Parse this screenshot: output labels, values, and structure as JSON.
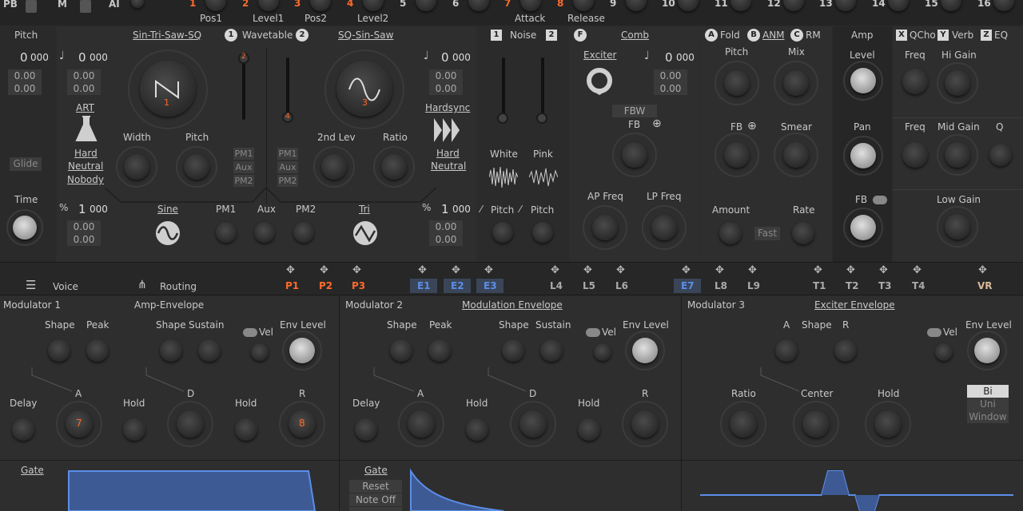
{
  "topbar": {
    "pb": "PB",
    "m": "M",
    "ai": "AI",
    "macros": [
      {
        "num": "1",
        "label": "Pos1",
        "accent": true
      },
      {
        "num": "2",
        "label": "Level1",
        "accent": true
      },
      {
        "num": "3",
        "label": "Pos2",
        "accent": true
      },
      {
        "num": "4",
        "label": "Level2",
        "accent": true
      },
      {
        "num": "5",
        "label": "",
        "accent": false
      },
      {
        "num": "6",
        "label": "",
        "accent": false
      },
      {
        "num": "7",
        "label": "Attack",
        "accent": true
      },
      {
        "num": "8",
        "label": "Release",
        "accent": true
      },
      {
        "num": "9",
        "label": "",
        "accent": false
      },
      {
        "num": "10",
        "label": "",
        "accent": false
      },
      {
        "num": "11",
        "label": "",
        "accent": false
      },
      {
        "num": "12",
        "label": "",
        "accent": false
      },
      {
        "num": "13",
        "label": "",
        "accent": false
      },
      {
        "num": "14",
        "label": "",
        "accent": false
      },
      {
        "num": "15",
        "label": "",
        "accent": false
      },
      {
        "num": "16",
        "label": "",
        "accent": false
      }
    ]
  },
  "pitch": {
    "title": "Pitch",
    "value": "0",
    "cents": "000",
    "f1": "0.00",
    "f2": "0.00",
    "glide": "Glide",
    "time": "Time"
  },
  "osc1": {
    "title": "Sin-Tri-Saw-SQ",
    "wavetable": "Wavetable",
    "b1": "1",
    "b2": "2",
    "knob_badge": "1",
    "slider_badge": "2",
    "coarse": "0",
    "cents": "000",
    "f1": "0.00",
    "f2": "0.00",
    "art": "ART",
    "art_l1": "Hard",
    "art_l2": "Neutral",
    "art_l3": "Nobody",
    "width": "Width",
    "pitch": "Pitch",
    "pm1": "PM1",
    "aux": "Aux",
    "pm2": "PM2"
  },
  "osc2": {
    "title": "SQ-Sin-Saw",
    "coarse": "0",
    "cents": "000",
    "f1": "0.00",
    "f2": "0.00",
    "knob_badge": "3",
    "slider_badge": "4",
    "hardsync": "Hardsync",
    "hs_l1": "Hard",
    "hs_l2": "Neutral",
    "lev": "2nd Lev",
    "ratio": "Ratio",
    "pm1": "PM1",
    "aux": "Aux",
    "pm2": "PM2"
  },
  "sub": {
    "pct": "%",
    "val": "1",
    "cents": "000",
    "f1": "0.00",
    "f2": "0.00",
    "sine": "Sine",
    "pm1": "PM1",
    "aux": "Aux",
    "pm2": "PM2",
    "tri": "Tri",
    "pct2": "%",
    "val2": "1",
    "cents2": "000",
    "f3": "0.00",
    "f4": "0.00"
  },
  "noise": {
    "b1": "1",
    "title": "Noise",
    "b2": "2",
    "white": "White",
    "pink": "Pink",
    "pitch1": "Pitch",
    "pitch2": "Pitch"
  },
  "comb": {
    "badge": "F",
    "title": "Comb",
    "exciter": "Exciter",
    "coarse": "0",
    "cents": "000",
    "f1": "0.00",
    "f2": "0.00",
    "fbw": "FBW",
    "fb": "FB",
    "ap": "AP Freq",
    "lp": "LP Freq"
  },
  "fold": {
    "a": "A",
    "fold": "Fold",
    "b": "B",
    "anm": "ANM",
    "c": "C",
    "rm": "RM",
    "pitch": "Pitch",
    "mix": "Mix",
    "fb": "FB",
    "smear": "Smear",
    "amount": "Amount",
    "fast": "Fast",
    "rate": "Rate"
  },
  "amp": {
    "title": "Amp",
    "level": "Level",
    "pan": "Pan",
    "fb": "FB"
  },
  "fx": {
    "x": "X",
    "qcho": "QCho",
    "y": "Y",
    "verb": "Verb",
    "z": "Z",
    "eq": "EQ",
    "freq1": "Freq",
    "hi": "Hi Gain",
    "freq2": "Freq",
    "mid": "Mid Gain",
    "q": "Q",
    "low": "Low Gain"
  },
  "modbar": {
    "voice": "Voice",
    "routing": "Routing",
    "slots": [
      {
        "label": "P1",
        "color": "orange"
      },
      {
        "label": "P2",
        "color": "orange"
      },
      {
        "label": "P3",
        "color": "orange"
      },
      {
        "label": "E1",
        "color": "blue"
      },
      {
        "label": "E2",
        "color": "blue"
      },
      {
        "label": "E3",
        "color": "blue"
      },
      {
        "label": "L4",
        "color": "grey"
      },
      {
        "label": "L5",
        "color": "grey"
      },
      {
        "label": "L6",
        "color": "grey"
      },
      {
        "label": "E7",
        "color": "blue"
      },
      {
        "label": "L8",
        "color": "grey"
      },
      {
        "label": "L9",
        "color": "grey"
      },
      {
        "label": "T1",
        "color": "grey"
      },
      {
        "label": "T2",
        "color": "grey"
      },
      {
        "label": "T3",
        "color": "grey"
      },
      {
        "label": "T4",
        "color": "grey"
      },
      {
        "label": "VR",
        "color": "tan"
      }
    ]
  },
  "mod1": {
    "title": "Modulator 1",
    "env": "Amp-Envelope",
    "shape1": "Shape",
    "peak": "Peak",
    "shape2": "Shape",
    "sustain": "Sustain",
    "vel": "Vel",
    "envlevel": "Env Level",
    "a": "A",
    "d": "D",
    "delay": "Delay",
    "hold1": "Hold",
    "hold2": "Hold",
    "r": "R",
    "a_badge": "7",
    "r_badge": "8",
    "gate": "Gate"
  },
  "mod2": {
    "title": "Modulator 2",
    "env": "Modulation Envelope",
    "shape1": "Shape",
    "peak": "Peak",
    "shape2": "Shape",
    "sustain": "Sustain",
    "vel": "Vel",
    "envlevel": "Env Level",
    "a": "A",
    "d": "D",
    "delay": "Delay",
    "hold1": "Hold",
    "hold2": "Hold",
    "r": "R",
    "gate": "Gate",
    "reset": "Reset",
    "noteoff": "Note Off"
  },
  "mod3": {
    "title": "Modulator 3",
    "env": "Exciter Envelope",
    "a": "A",
    "shape": "Shape",
    "r": "R",
    "vel": "Vel",
    "envlevel": "Env Level",
    "ratio": "Ratio",
    "center": "Center",
    "hold": "Hold",
    "bi": "Bi",
    "uni": "Uni",
    "window": "Window"
  },
  "colors": {
    "accent": "#ff6a2b",
    "blue": "#5c8ee8",
    "envfill": "#3d5a94"
  }
}
